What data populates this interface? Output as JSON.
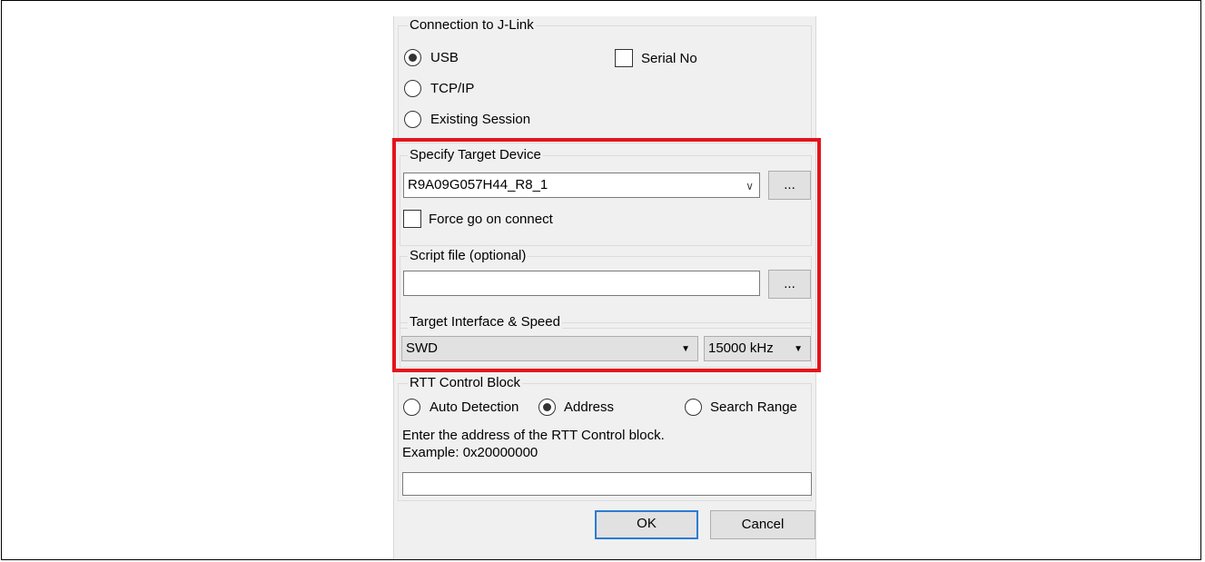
{
  "connection": {
    "legend": "Connection to J-Link",
    "usb_label": "USB",
    "usb_checked": true,
    "serial_label": "Serial No",
    "tcpip_label": "TCP/IP",
    "existing_label": "Existing Session"
  },
  "target_device": {
    "legend": "Specify Target Device",
    "device_value": "R9A09G057H44_R8_1",
    "browse_label": "...",
    "force_go_label": "Force go on connect"
  },
  "script_file": {
    "legend": "Script file (optional)",
    "value": "",
    "browse_label": "..."
  },
  "interface_speed": {
    "legend": "Target Interface & Speed",
    "interface_value": "SWD",
    "speed_value": "15000 kHz"
  },
  "rtt": {
    "legend": "RTT Control Block",
    "auto_label": "Auto Detection",
    "address_label": "Address",
    "address_checked": true,
    "search_label": "Search Range",
    "hint_line1": "Enter the address of the RTT Control block.",
    "hint_line2": "Example: 0x20000000",
    "address_value": ""
  },
  "buttons": {
    "ok_label": "OK",
    "cancel_label": "Cancel"
  },
  "colors": {
    "highlight": "#e4141b",
    "dialog_bg": "#f0f0f0",
    "default_button_border": "#2b7bd6"
  }
}
